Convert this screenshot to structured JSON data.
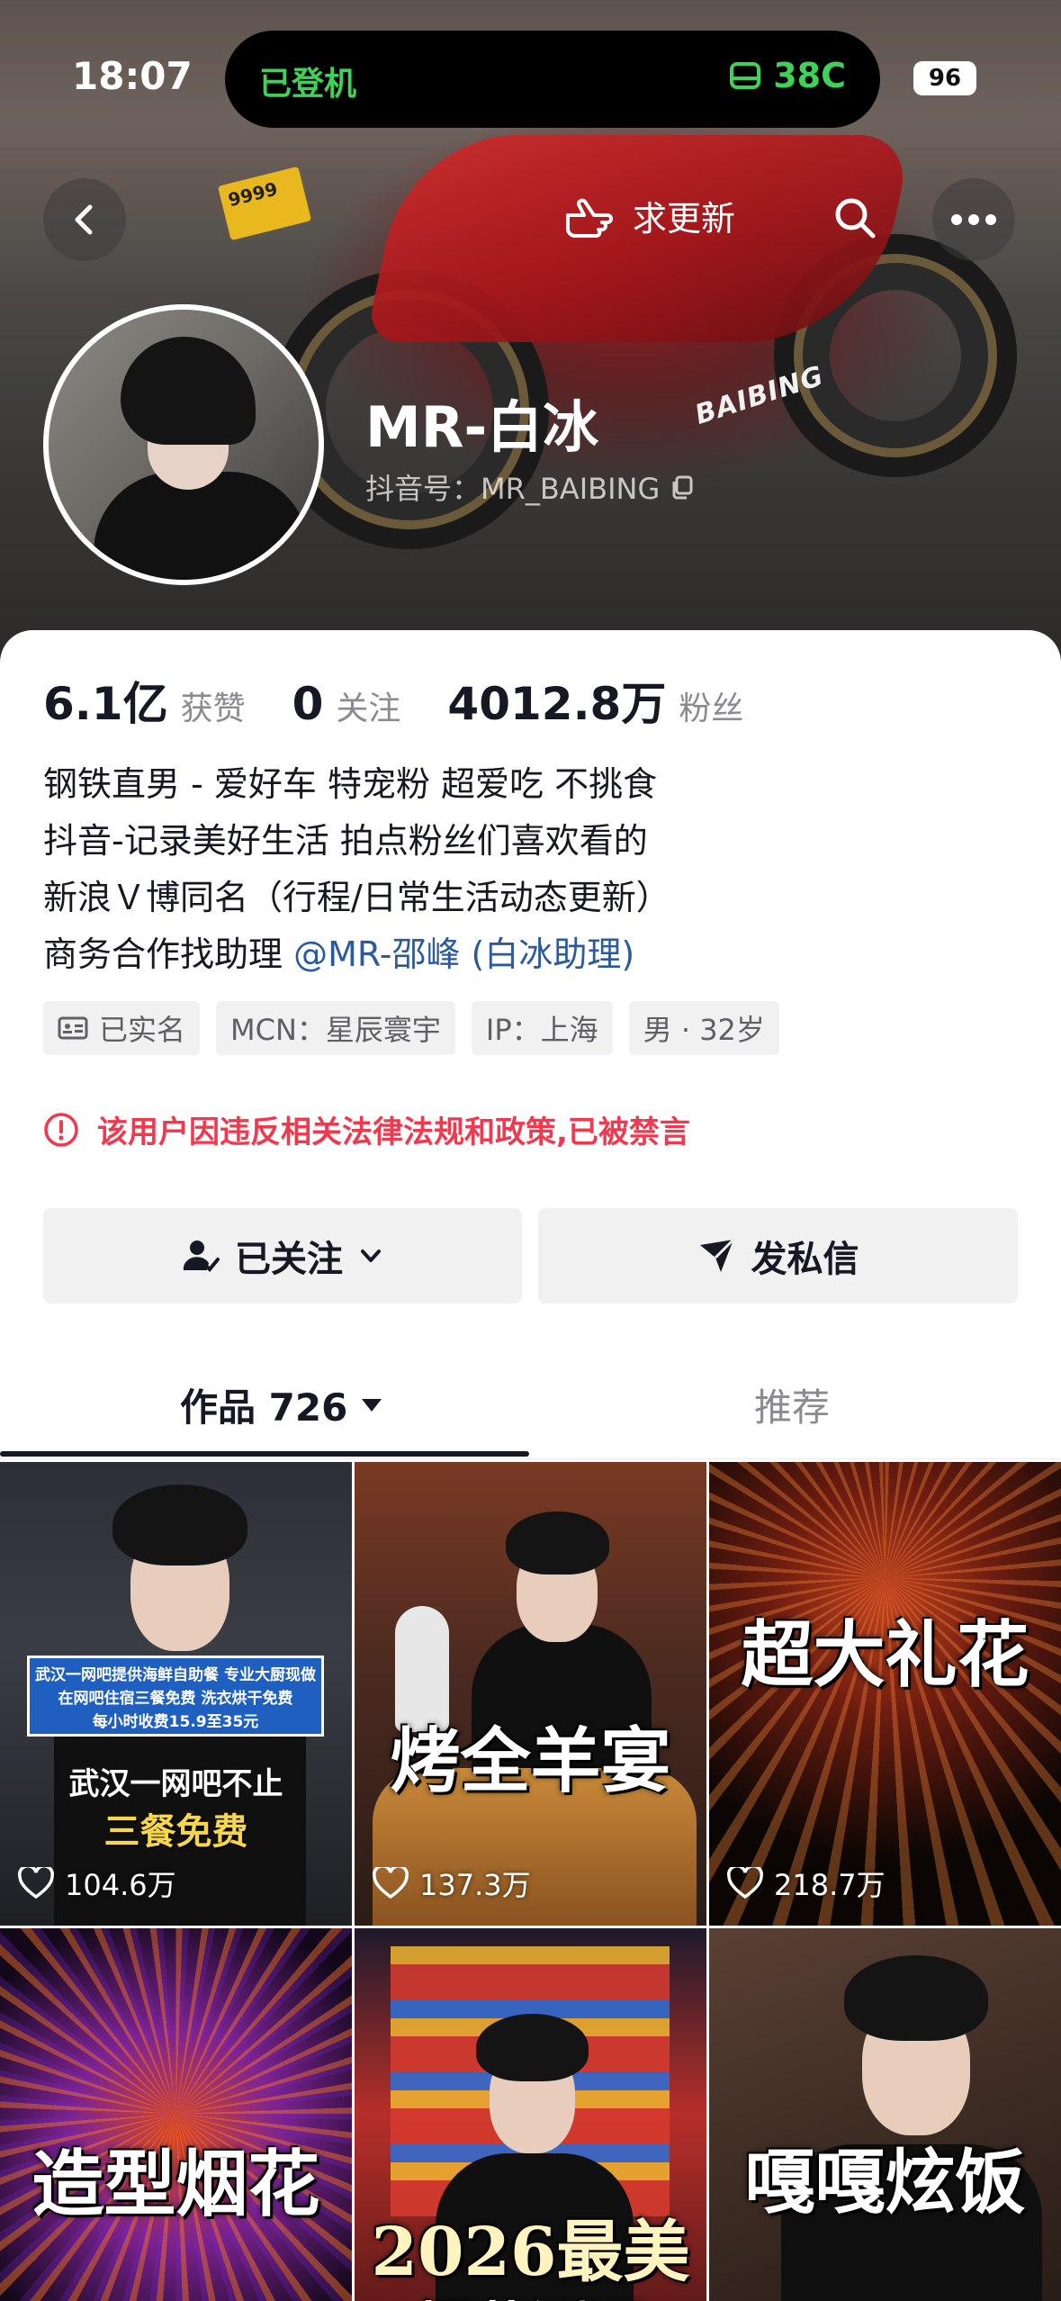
{
  "status_bar": {
    "time": "18:07",
    "island_left": "已登机",
    "island_right": "38C",
    "battery": "96"
  },
  "nav": {
    "update_label": "求更新"
  },
  "profile": {
    "nickname": "MR-白冰",
    "douyin_id": "抖音号：MR_BAIBING",
    "banner_brand_text": "BAIBING",
    "banner_plate_text": "9999"
  },
  "stats": [
    {
      "num": "6.1亿",
      "label": "获赞"
    },
    {
      "num": "0",
      "label": "关注"
    },
    {
      "num": "4012.8万",
      "label": "粉丝"
    }
  ],
  "bio": {
    "line1": "钢铁直男 - 爱好车 特宠粉 超爱吃 不挑食",
    "line2": "抖音-记录美好生活 拍点粉丝们喜欢看的",
    "line3": "新浪Ｖ博同名（行程/日常生活动态更新）",
    "line4_prefix": "商务合作找助理",
    "line4_mention": "@MR-邵峰 (白冰助理)"
  },
  "tags": [
    "已实名",
    "MCN：星辰寰宇",
    "IP：上海",
    "男 · 32岁"
  ],
  "ban_notice": "该用户因违反相关法律法规和政策,已被禁言",
  "buttons": {
    "follow": "已关注",
    "message": "发私信"
  },
  "tabs": {
    "works": "作品 726",
    "recommend": "推荐"
  },
  "videos": [
    {
      "likes": "104.6万",
      "news_line1": "武汉一网吧提供海鲜自助餐 专业大厨现做",
      "news_line2": "在网吧住宿三餐免费 洗衣烘干免费",
      "news_line3": "每小时收费15.9至35元",
      "caption1": "武汉一网吧不止",
      "caption2": "三餐免费"
    },
    {
      "likes": "137.3万",
      "caption": "烤全羊宴"
    },
    {
      "likes": "218.7万",
      "caption": "超大礼花"
    },
    {
      "likes": "",
      "caption": "造型烟花"
    },
    {
      "likes": "",
      "caption": "2026最美",
      "caption2": "“烟花测评”"
    },
    {
      "likes": "",
      "caption": "嘎嘎炫饭"
    }
  ],
  "colors": {
    "accent_red": "#f0384f",
    "mention_blue": "#2d5a9c",
    "island_green": "#3fd158"
  }
}
